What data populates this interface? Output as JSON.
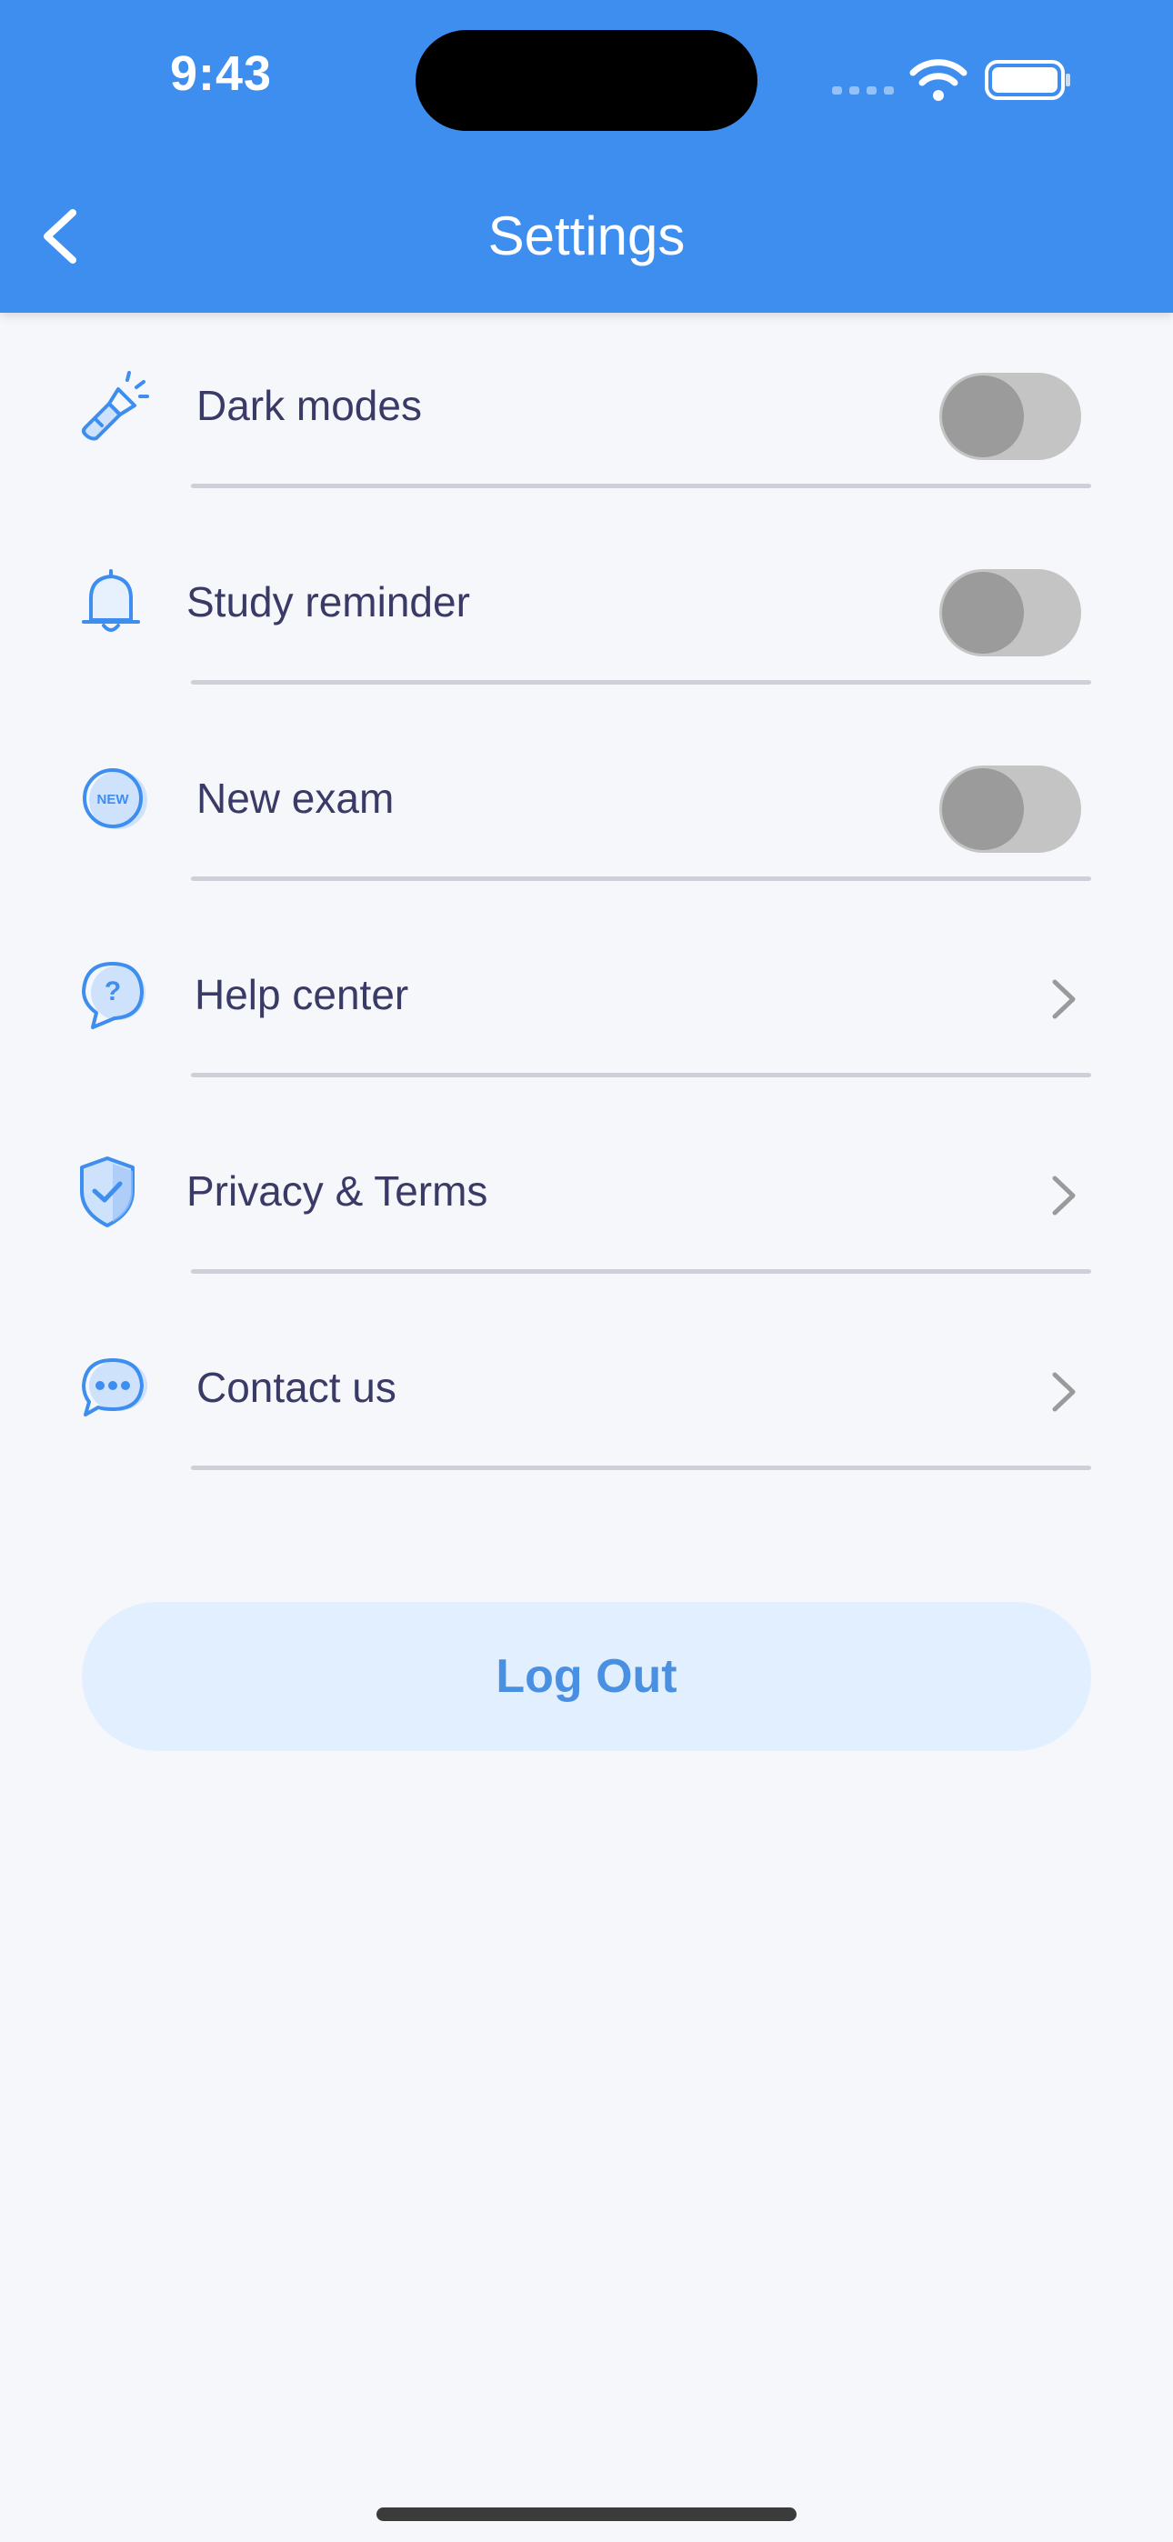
{
  "status_bar": {
    "time": "9:43"
  },
  "header": {
    "title": "Settings",
    "background_color": "#3e8ef0"
  },
  "settings": {
    "items": [
      {
        "label": "Dark modes",
        "icon": "flashlight-icon",
        "control": "toggle",
        "on": false
      },
      {
        "label": "Study reminder",
        "icon": "bell-icon",
        "control": "toggle",
        "on": false
      },
      {
        "label": "New exam",
        "icon": "new-badge-icon",
        "control": "toggle",
        "on": false
      },
      {
        "label": "Help center",
        "icon": "help-bubble-icon",
        "control": "chevron"
      },
      {
        "label": "Privacy & Terms",
        "icon": "shield-check-icon",
        "control": "chevron"
      },
      {
        "label": "Contact us",
        "icon": "chat-bubble-icon",
        "control": "chevron"
      }
    ]
  },
  "logout": {
    "label": "Log Out"
  },
  "colors": {
    "accent": "#3e8ef0",
    "text": "#3a3a66",
    "toggle_off_track": "#c4c4c4",
    "logout_bg": "#e2efff",
    "logout_text": "#4a90e2"
  }
}
